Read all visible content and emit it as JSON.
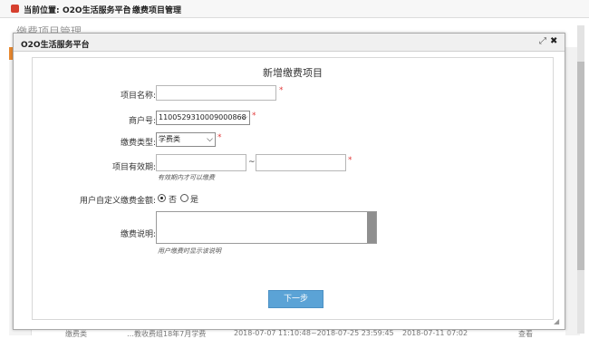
{
  "breadcrumb": {
    "label": "当前位置:",
    "link": "O2O生活服务平台",
    "separator": ">",
    "current": "缴费项目管理"
  },
  "background": {
    "section_title": "缴费项目管理",
    "row": [
      "缴费类",
      "…教收费组18年7月学费",
      "2018-07-07 11:10:48~2018-07-25 23:59:45",
      "2018-07-11 07:02",
      "查看"
    ]
  },
  "modal": {
    "title": "O2O生活服务平台",
    "form_title": "新增缴费项目",
    "fields": {
      "project_name": {
        "label": "项目名称:",
        "value": "",
        "required": "*"
      },
      "merchant_no": {
        "label": "商户号:",
        "value": "1100529310009000868",
        "required": "*"
      },
      "fee_type": {
        "label": "缴费类型:",
        "value": "学费类",
        "required": "*"
      },
      "validity": {
        "label": "项目有效期:",
        "start_value": "",
        "separator": "~",
        "end_value": "",
        "required": "*",
        "hint": "有效期内才可以缴费"
      },
      "custom_amount": {
        "label": "用户自定义缴费金额:",
        "options": [
          "否",
          "是"
        ],
        "selected": "否"
      },
      "description": {
        "label": "缴费说明:",
        "value": "",
        "hint": "用户缴费时显示该说明"
      }
    },
    "next_button": "下一步"
  }
}
